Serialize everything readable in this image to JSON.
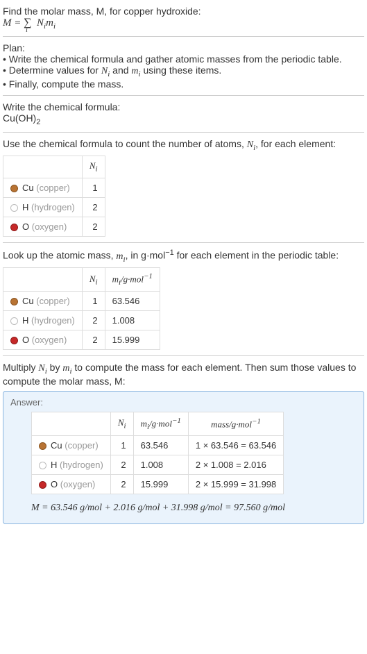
{
  "intro": {
    "line1": "Find the molar mass, M, for copper hydroxide:"
  },
  "plan": {
    "title": "Plan:",
    "b1": "• Write the chemical formula and gather atomic masses from the periodic table.",
    "b2_pre": "• Determine values for ",
    "b2_mid": " and ",
    "b2_post": " using these items.",
    "b3": "• Finally, compute the mass."
  },
  "write_formula": {
    "title": "Write the chemical formula:",
    "formula_main": "Cu(OH)",
    "formula_sub": "2"
  },
  "count": {
    "title_pre": "Use the chemical formula to count the number of atoms, ",
    "title_post": ", for each element:"
  },
  "lookup": {
    "title_pre": "Look up the atomic mass, ",
    "title_mid": ", in g·mol",
    "title_post": " for each element in the periodic table:"
  },
  "multiply": {
    "line1_pre": "Multiply ",
    "line1_mid": " by ",
    "line1_post": " to compute the mass for each element. Then sum those values to compute the molar mass, M:"
  },
  "answer_label": "Answer:",
  "headers": {
    "ni": "N",
    "ni_sub": "i",
    "mi": "m",
    "mi_sub": "i",
    "mi_unit": "/g·mol",
    "neg1": "−1",
    "mass": "mass/g·mol"
  },
  "elements": {
    "cu": {
      "sym": "Cu",
      "name": " (copper)",
      "n": "1",
      "m": "63.546",
      "mass": "1 × 63.546 = 63.546"
    },
    "h": {
      "sym": "H",
      "name": " (hydrogen)",
      "n": "2",
      "m": "1.008",
      "mass": "2 × 1.008 = 2.016"
    },
    "o": {
      "sym": "O",
      "name": " (oxygen)",
      "n": "2",
      "m": "15.999",
      "mass": "2 × 15.999 = 31.998"
    }
  },
  "final": {
    "eq": "M = 63.546 g/mol + 2.016 g/mol + 31.998 g/mol = 97.560 g/mol"
  },
  "chart_data": {
    "type": "table",
    "elements": [
      {
        "element": "Cu (copper)",
        "N_i": 1,
        "m_i_g_per_mol": 63.546,
        "mass_g_per_mol": 63.546
      },
      {
        "element": "H (hydrogen)",
        "N_i": 2,
        "m_i_g_per_mol": 1.008,
        "mass_g_per_mol": 2.016
      },
      {
        "element": "O (oxygen)",
        "N_i": 2,
        "m_i_g_per_mol": 15.999,
        "mass_g_per_mol": 31.998
      }
    ],
    "molar_mass_g_per_mol": 97.56
  }
}
